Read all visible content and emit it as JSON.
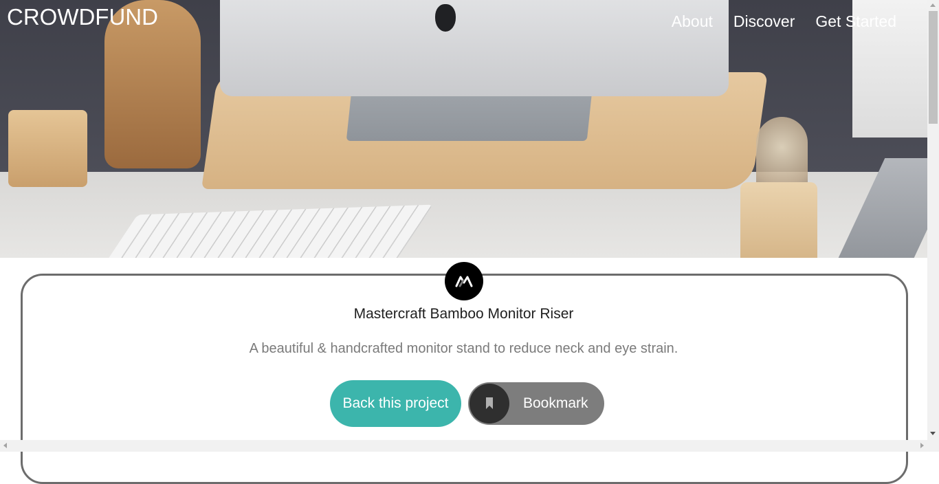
{
  "header": {
    "logo": "CROWDFUND",
    "nav": [
      {
        "label": "About"
      },
      {
        "label": "Discover"
      },
      {
        "label": "Get Started"
      }
    ]
  },
  "hero": {
    "image": "desk-with-monitor-on-bamboo-riser"
  },
  "project": {
    "logo_icon": "mastercraft-logo-icon",
    "title": "Mastercraft Bamboo Monitor Riser",
    "description": "A beautiful & handcrafted monitor stand to reduce neck and eye strain.",
    "back_label": "Back this project",
    "bookmark_label": "Bookmark",
    "bookmark_icon": "bookmark-icon"
  },
  "colors": {
    "accent": "#3cb5ac",
    "bookmark_bg": "#7d7d7d",
    "bookmark_circle": "#2f2f2f",
    "card_border": "#6c6c6c"
  }
}
